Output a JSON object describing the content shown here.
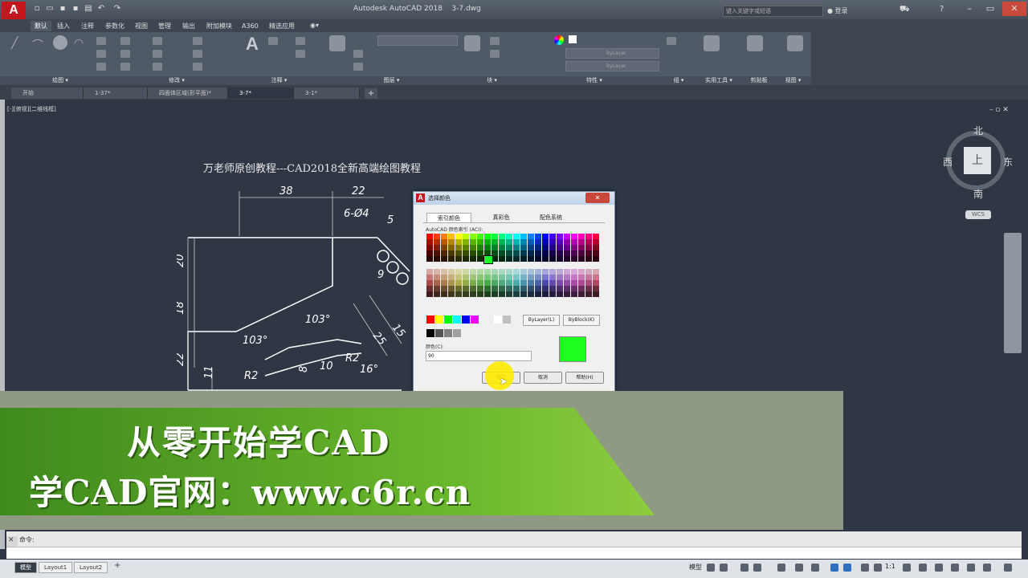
{
  "app": {
    "title": "Autodesk AutoCAD 2018",
    "file": "3-7.dwg",
    "logo_letter": "A",
    "search_placeholder": "键入关键字或短语",
    "sign_in": "登录"
  },
  "ribbon": {
    "tabs": [
      "默认",
      "插入",
      "注释",
      "参数化",
      "视图",
      "管理",
      "输出",
      "附加模块",
      "A360",
      "精选应用"
    ],
    "active_tab": "默认",
    "panels": [
      "绘图",
      "修改",
      "注释",
      "图层",
      "块",
      "特性",
      "组",
      "实用工具",
      "剪贴板",
      "视图"
    ],
    "layer_dropdown": "ByLayer",
    "lineweight_dropdown": "ByLayer"
  },
  "doc_tabs": [
    "开始",
    "1-37*",
    "四面体区域(形平面)*",
    "3-7*",
    "3-1*"
  ],
  "active_doc_tab": "3-7*",
  "viewport_label": "[-][俯视][二维线框]",
  "drawing": {
    "title": "万老师原创教程---CAD2018全新高端绘图教程",
    "dims": [
      "38",
      "22",
      "6-Ø4",
      "20",
      "18",
      "22",
      "11",
      "103°",
      "103°",
      "R2",
      "R2",
      "16°",
      "10",
      "8",
      "3",
      "15",
      "25",
      "9",
      "5"
    ]
  },
  "viewcube": {
    "north": "北",
    "south": "南",
    "east": "东",
    "west": "西",
    "face": "上",
    "wcs": "WCS"
  },
  "dialog": {
    "title": "选择颜色",
    "tabs": [
      "索引颜色",
      "真彩色",
      "配色系统"
    ],
    "aci_label": "AutoCAD 颜色索引 (ACI):",
    "bylayer": "ByLayer(L)",
    "byblock": "ByBlock(K)",
    "color_label": "颜色(C):",
    "color_value": "90",
    "selected_color": "#1fff1f",
    "ok": "确定",
    "cancel": "取消",
    "help": "帮助(H)"
  },
  "banner": {
    "line1": "从零开始学CAD",
    "line2": "学CAD官网：www.c6r.cn"
  },
  "command": {
    "prompt": "命令:"
  },
  "layout_tabs": [
    "模型",
    "Layout1",
    "Layout2"
  ],
  "status": {
    "model": "模型",
    "scale": "1:1"
  }
}
